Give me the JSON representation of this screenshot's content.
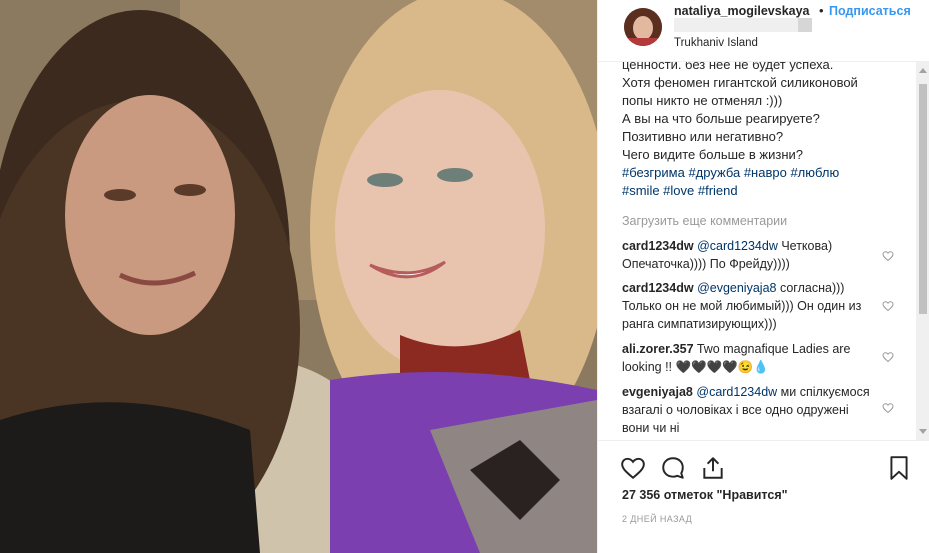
{
  "post": {
    "username": "nataliya_mogilevskaya",
    "separator": "•",
    "follow_label": "Подписаться",
    "location": "Trukhaniv Island"
  },
  "caption": {
    "line1": "ценности. без нее не будет успеха.",
    "line2": "Хотя феномен гигантской силиконовой",
    "line3": "попы никто не отменял :)))",
    "line4": "А вы на что больше реагируете?",
    "line5": "Позитивно или негативно?",
    "line6": "Чего видите больше в жизни?",
    "tags1": "#безгрима #дружба #навро #люблю",
    "tags2": "#smile #love #friend"
  },
  "load_more": "Загрузить еще комментарии",
  "comments": [
    {
      "user": "card1234dw",
      "mention": "@card1234dw",
      "text": "Четкова) Опечаточка)))) По Фрейду))))"
    },
    {
      "user": "card1234dw",
      "mention": "@evgeniyaja8",
      "text": "согласна))) Только он не мой любимый))) Он один из ранга симпатизирующих)))"
    },
    {
      "user": "ali.zorer.357",
      "mention": "",
      "text": "Two magnafique Ladies are looking !! 🖤🖤🖤🖤😉💧"
    },
    {
      "user": "evgeniyaja8",
      "mention": "@card1234dw",
      "text": "ми спілкуємося взагалі о чоловіках і все одно одружені вони чи ні"
    }
  ],
  "likes": "27 356 отметок \"Нравится\"",
  "time_ago": "2 ДНЕЙ НАЗАД",
  "icons": {
    "like": "heart-icon",
    "comment": "comment-icon",
    "share": "share-icon",
    "save": "bookmark-icon"
  },
  "colors": {
    "link": "#3897f0",
    "hashtag": "#003569",
    "muted": "#999999"
  }
}
